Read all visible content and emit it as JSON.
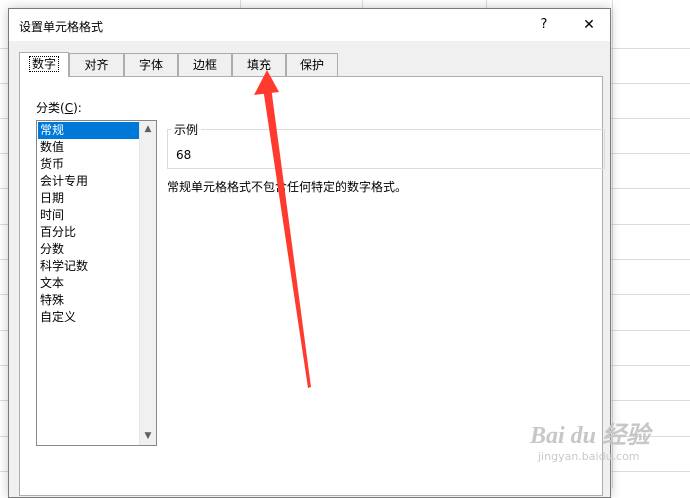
{
  "dialog": {
    "title": "设置单元格格式",
    "help_label": "?",
    "close_label": "✕"
  },
  "tabs": [
    {
      "label": "数字",
      "active": true
    },
    {
      "label": "对齐",
      "active": false
    },
    {
      "label": "字体",
      "active": false
    },
    {
      "label": "边框",
      "active": false
    },
    {
      "label": "填充",
      "active": false
    },
    {
      "label": "保护",
      "active": false
    }
  ],
  "category": {
    "label_prefix": "分类(",
    "label_key": "C",
    "label_suffix": "):",
    "items": [
      "常规",
      "数值",
      "货币",
      "会计专用",
      "日期",
      "时间",
      "百分比",
      "分数",
      "科学记数",
      "文本",
      "特殊",
      "自定义"
    ],
    "selected": "常规"
  },
  "sample": {
    "legend": "示例",
    "value": "68"
  },
  "description": "常规单元格格式不包含任何特定的数字格式。",
  "annotation": {
    "type": "red arrow pointing to 填充 tab",
    "color": "#ff3b30"
  },
  "watermark": {
    "main": "Bai du 经验",
    "sub": "jingyan.baidu.com"
  },
  "colors": {
    "selection": "#0078d7",
    "dialog_bg": "#f0f0f0",
    "panel_bg": "#ffffff"
  }
}
